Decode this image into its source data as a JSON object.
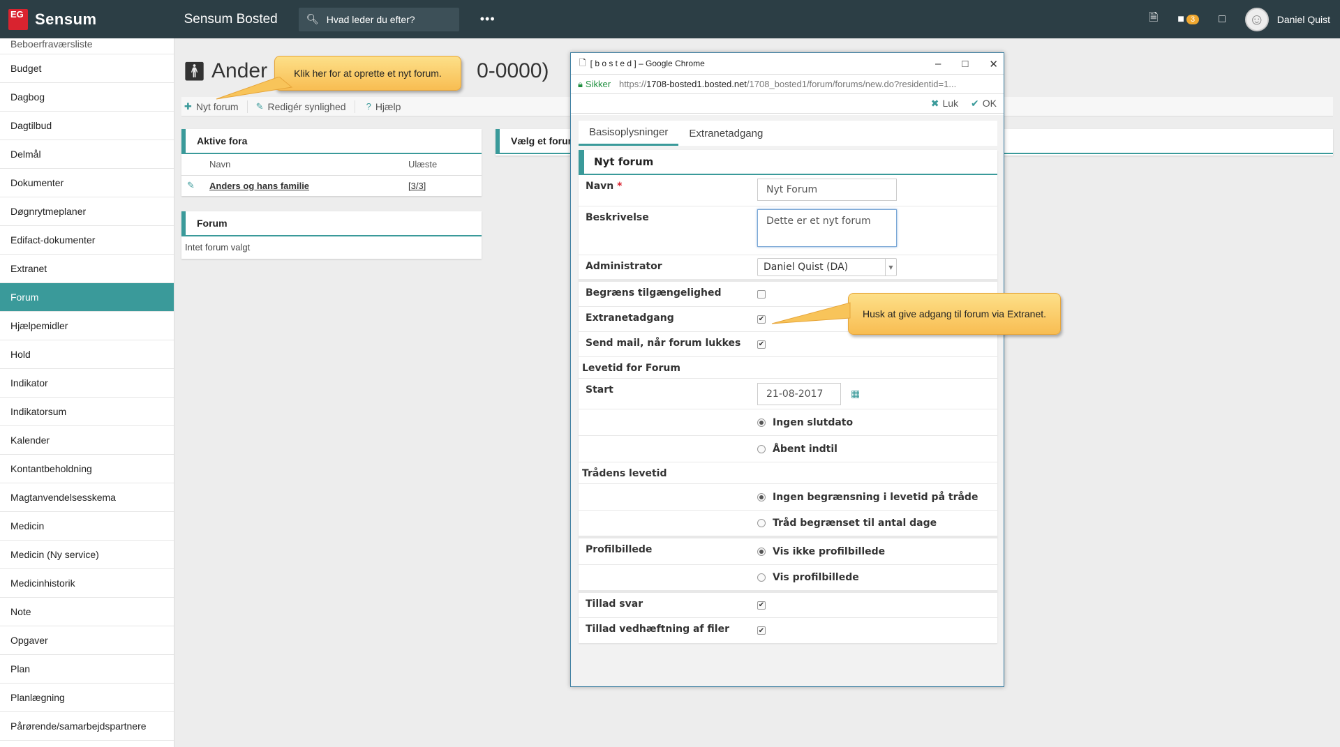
{
  "topbar": {
    "logo_mark": "EG",
    "logo_text": "Sensum",
    "app_title": "Sensum Bosted",
    "search_placeholder": "Hvad leder du efter?",
    "more": "•••",
    "chat_badge": "3",
    "username": "Daniel Quist"
  },
  "sidebar": {
    "items": [
      {
        "label": "Beboerfraværsliste"
      },
      {
        "label": "Budget"
      },
      {
        "label": "Dagbog"
      },
      {
        "label": "Dagtilbud"
      },
      {
        "label": "Delmål"
      },
      {
        "label": "Dokumenter"
      },
      {
        "label": "Døgnrytmeplaner"
      },
      {
        "label": "Edifact-dokumenter"
      },
      {
        "label": "Extranet"
      },
      {
        "label": "Forum"
      },
      {
        "label": "Hjælpemidler"
      },
      {
        "label": "Hold"
      },
      {
        "label": "Indikator"
      },
      {
        "label": "Indikatorsum"
      },
      {
        "label": "Kalender"
      },
      {
        "label": "Kontantbeholdning"
      },
      {
        "label": "Magtanvendelsesskema"
      },
      {
        "label": "Medicin"
      },
      {
        "label": "Medicin (Ny service)"
      },
      {
        "label": "Medicinhistorik"
      },
      {
        "label": "Note"
      },
      {
        "label": "Opgaver"
      },
      {
        "label": "Plan"
      },
      {
        "label": "Planlægning"
      },
      {
        "label": "Pårørende/samarbejdspartnere"
      }
    ]
  },
  "main": {
    "person_name_start": "Ander",
    "person_name_end": "0-0000)",
    "toolbar": {
      "new_forum": "Nyt forum",
      "edit_visibility": "Redigér synlighed",
      "help": "Hjælp"
    },
    "active_fora": {
      "title": "Aktive fora",
      "col_name": "Navn",
      "col_unread": "Ulæste",
      "rows": [
        {
          "name": "Anders og hans familie",
          "unread": "[3/3]"
        }
      ]
    },
    "forum_panel": {
      "title": "Forum",
      "empty": "Intet forum valgt"
    },
    "choose_forum": "Vælg et forum"
  },
  "callouts": {
    "new_forum_tip": "Klik her for at oprette et nyt forum.",
    "extranet_tip": "Husk at give adgang til forum via Extranet."
  },
  "popup": {
    "window_title": "[ b o s t e d ] – Google Chrome",
    "secure": "Sikker",
    "url_scheme": "https://",
    "url_host": "1708-bosted1.bosted.net",
    "url_path": "/1708_bosted1/forum/forums/new.do?residentid=1...",
    "close": "Luk",
    "ok": "OK",
    "tabs": [
      "Basisoplysninger",
      "Extranetadgang"
    ],
    "form_title": "Nyt forum",
    "fields": {
      "name_label": "Navn",
      "required_mark": "*",
      "name_value": "Nyt Forum",
      "description_label": "Beskrivelse",
      "description_value": "Dette er et nyt forum",
      "administrator_label": "Administrator",
      "administrator_value": "Daniel Quist (DA)",
      "restrict_label": "Begræns tilgængelighed",
      "restrict_checked": false,
      "extranet_label": "Extranetadgang",
      "extranet_checked": true,
      "sendmail_label": "Send mail, når forum lukkes",
      "sendmail_checked": true,
      "lifetime_section": "Levetid for Forum",
      "start_label": "Start",
      "start_value": "21-08-2017",
      "no_enddate": "Ingen slutdato",
      "open_until": "Åbent indtil",
      "thread_section": "Trådens levetid",
      "thread_no_limit": "Ingen begrænsning i levetid på tråde",
      "thread_limited": "Tråd begrænset til antal dage",
      "profile_label": "Profilbillede",
      "profile_hide": "Vis ikke profilbillede",
      "profile_show": "Vis profilbillede",
      "allow_reply_label": "Tillad svar",
      "allow_reply_checked": true,
      "allow_attach_label": "Tillad vedhæftning af filer",
      "allow_attach_checked": true
    }
  },
  "colors": {
    "accent": "#3a9a9a",
    "topbar": "#2c3e45",
    "brand_red": "#d9232f",
    "callout": "#f8bd52"
  }
}
